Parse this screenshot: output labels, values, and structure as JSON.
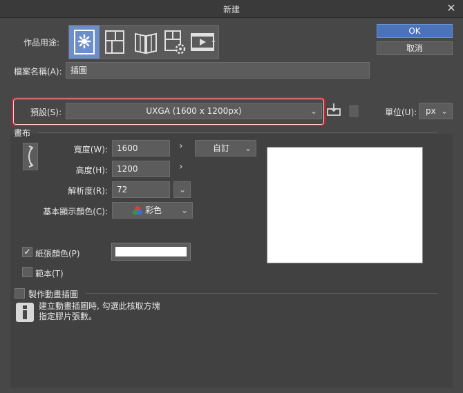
{
  "window": {
    "title": "新建",
    "close_glyph": "✕"
  },
  "usage": {
    "label": "作品用途:",
    "icons": [
      {
        "name": "illustration-icon",
        "active": true
      },
      {
        "name": "comic-page-icon",
        "active": false
      },
      {
        "name": "book-icon",
        "active": false
      },
      {
        "name": "page-settings-icon",
        "active": false
      },
      {
        "name": "animation-icon",
        "active": false
      }
    ],
    "more_glyph": "⌄"
  },
  "buttons": {
    "ok": "OK",
    "cancel": "取消"
  },
  "filename": {
    "label": "檔案名稱(A):",
    "value": "插圖"
  },
  "preset": {
    "label": "預設(S):",
    "value": "UXGA (1600 x 1200px)",
    "highlight_color": "#c8232d"
  },
  "unit": {
    "label": "單位(U):",
    "value": "px"
  },
  "canvas": {
    "section_label": "畫布",
    "width_label": "寬度(W):",
    "width_value": "1600",
    "height_label": "高度(H):",
    "height_value": "1200",
    "size_preset": "自訂",
    "resolution_label": "解析度(R):",
    "resolution_value": "72",
    "color_label": "基本顯示顏色(C):",
    "color_value": "彩色",
    "paper_label": "紙張顏色(P)",
    "paper_checked": true,
    "paper_color": "#ffffff",
    "template_label": "範本(T)",
    "template_checked": false
  },
  "animation": {
    "label": "製作動畫插圖",
    "checked": false,
    "info_line1": "建立動畫插圖時, 勾選此核取方塊",
    "info_line2": "指定膠片張數。"
  },
  "accent_color": "#4a73b9"
}
